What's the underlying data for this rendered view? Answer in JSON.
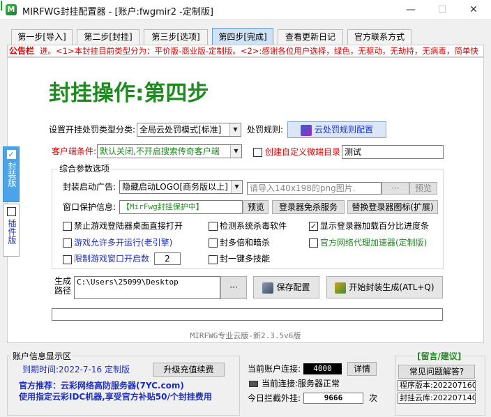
{
  "window": {
    "app_icon_letter": "M",
    "title": "MIRFWG封挂配置器 - [账户:fwgmir2 -定制版]",
    "minimize": "—",
    "maximize": "☐",
    "close": "✕"
  },
  "tabs": [
    {
      "label": "第一步[导入]"
    },
    {
      "label": "第二步[封挂]"
    },
    {
      "label": "第三步[选项]"
    },
    {
      "label": "第四步[完成]"
    },
    {
      "label": "查看更新日记"
    },
    {
      "label": "官方联系方式"
    }
  ],
  "marquee": {
    "label": "公告栏",
    "text": "进。<1>本封挂目前类型分为：平价版-商业版-定制版。<2>:感谢各位用户选择，绿色，无驱动，无劫持，无病毒，简单快"
  },
  "heading": "封挂操作:第四步",
  "punish": {
    "label": "设置开挂处罚类型分类:",
    "value": "全局云处罚模式[标准]",
    "rule_label": "处罚规则:",
    "rule_button": "云处罚规则配置"
  },
  "client": {
    "label": "客户端条件:",
    "value": "默认关闭,不开启搜索传奇客户端",
    "custom_dir_label": "创建自定义微端目录",
    "custom_dir_value": "测试"
  },
  "group": {
    "title": "综合参数选项",
    "ad_label": "封装启动广告:",
    "ad_value": "隐藏启动LOGO[商务版以上]",
    "ad_image_placeholder": "请导入140x198的png图片.",
    "ad_browse": "···",
    "ad_preview": "预览",
    "protect_label": "窗口保护信息:",
    "protect_value": "【MirFwg封挂保护中】",
    "protect_preview": "预览",
    "login_kill_btn": "登录器免杀服务",
    "replace_icon_btn": "替换登录器图标(扩展)",
    "options": [
      {
        "label": "禁止游戏登陆器桌面直接打开",
        "checked": false,
        "color": "#000000"
      },
      {
        "label": "检测系统杀毒软件",
        "checked": false,
        "color": "#000000"
      },
      {
        "label": "显示登录器加载百分比进度条",
        "checked": true,
        "color": "#000000"
      },
      {
        "label": "游戏允许多开运行(老引擎)",
        "checked": false,
        "color": "#1e2fc0"
      },
      {
        "label": "封多倍和暗杀",
        "checked": false,
        "color": "#000000"
      },
      {
        "label": "官方网络代理加速器(定制版)",
        "checked": false,
        "color": "#1f8a1f"
      },
      {
        "label": "限制游戏窗口开启数",
        "checked": false,
        "color": "#1e2fc0"
      },
      {
        "label": "封一键多技能",
        "checked": false,
        "color": "#000000"
      }
    ],
    "window_limit_value": "2"
  },
  "output": {
    "label_line1": "生成",
    "label_line2": "路径",
    "path": "C:\\Users\\25099\\Desktop",
    "browse": "···",
    "save_btn": "保存配置",
    "generate_btn": "开始封装生成(ATL+Q)"
  },
  "progress": {
    "fraction": 0.003
  },
  "version_text": "MIRFWG专业云版-新2.3.5v6版",
  "side_tabs": [
    {
      "label": "封装版",
      "checked": true
    },
    {
      "label": "插件版",
      "checked": false
    }
  ],
  "account": {
    "title": "账户信息显示区",
    "expire": "到期时间:2022-7-16 定制版",
    "renew_btn": "升级充值续费",
    "recommend": "官方推荐：云彩网络高防服务器(7YC.com)",
    "promo": "使用指定云彩IDC机器,享受官方补贴50/个封挂费用",
    "conn_label": "当前账户连接:",
    "conn_value": "4000",
    "detail_btn": "详情",
    "status_label": "当前连接:服务器正常",
    "blocked_label": "今日拦截外挂:",
    "blocked_value": "9666",
    "blocked_unit": "次"
  },
  "feedback": {
    "title": "[留言/建议]",
    "faq_btn": "常见问题解答?",
    "program_version": "程序版本:202207160",
    "plugin_lib": "封挂云库:202207140"
  },
  "colors": {
    "accent_green": "#1f8a1f",
    "alert_red": "#e00000",
    "link_blue": "#1e2fc0",
    "active_tab": "#cfe3f7",
    "progress_green": "#06b025"
  }
}
